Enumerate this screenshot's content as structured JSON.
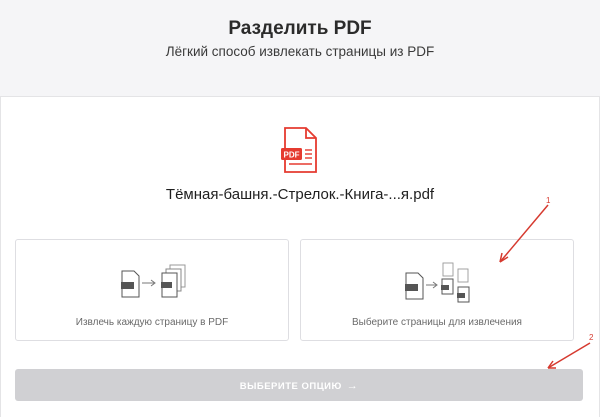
{
  "header": {
    "title": "Разделить PDF",
    "subtitle": "Лёгкий способ извлекать страницы из PDF"
  },
  "file": {
    "icon_text": "PDF",
    "name": "Тёмная-башня.-Стрелок.-Книга-...я.pdf"
  },
  "options": [
    {
      "label": "Извлечь каждую страницу в PDF",
      "icon": "extract-all-pages-icon"
    },
    {
      "label": "Выберите страницы для извлечения",
      "icon": "select-pages-icon"
    }
  ],
  "action": {
    "label": "ВЫБЕРИТЕ ОПЦИЮ",
    "arrow": "→"
  },
  "annotations": {
    "marker_1": "1",
    "marker_2": "2"
  },
  "colors": {
    "accent": "#e53b30",
    "annotation": "#d63a2f",
    "button_disabled": "#d0d0d3"
  }
}
